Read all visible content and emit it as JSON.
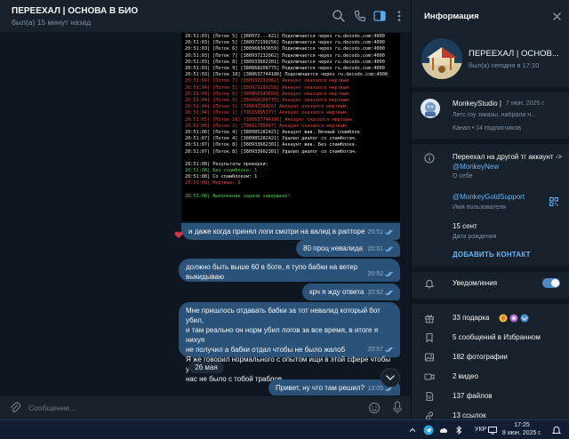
{
  "chat": {
    "title": "ПЕРЕЕХАЛ | ОСНОВА В БИО",
    "status": "был(а) 15 минут назад",
    "input_placeholder": "Сообщение..."
  },
  "terminal_lines": [
    {
      "c": "w",
      "t": "20:51:03| [Поток 5] [380972...421] Подключается через ru.decodo.com:4000"
    },
    {
      "c": "w",
      "t": "20:51:03| [Поток 5] [380972190256] Подключается через ru.decodo.com:4000"
    },
    {
      "c": "w",
      "t": "20:51:03| [Поток 6] [380968343659] Подключается через ru.decodo.com:4000"
    },
    {
      "c": "w",
      "t": "20:51:03| [Поток 7] [380937232062] Подключается через ru.decodo.com:4000"
    },
    {
      "c": "w",
      "t": "20:51:03| [Поток 8] [380933662301] Подключается через ru.decodo.com:4000"
    },
    {
      "c": "w",
      "t": "20:51:03| [Поток 9] [380868208775] Подключается через ru.decodo.com:4000"
    },
    {
      "c": "w",
      "t": "20:51:03| [Поток 10] [380637744186] Подключается через ru.decodo.com:4000"
    },
    {
      "c": "r",
      "t": "20:51:04| [Поток 7] [380937232062] Аккаунт оказался мертвым."
    },
    {
      "c": "r",
      "t": "20:51:04| [Поток 5] [380972190256] Аккаунт оказался мертвым."
    },
    {
      "c": "r",
      "t": "20:51:04| [Поток 6] [380968343659] Аккаунт оказался мертвым."
    },
    {
      "c": "r",
      "t": "20:51:04| [Поток 9] [380868208775] Аккаунт оказался мертвым."
    },
    {
      "c": "r",
      "t": "20:51:04| [Поток 3] [79014728420] Аккаунт оказался мертвым."
    },
    {
      "c": "r",
      "t": "20:51:04| [Поток 1] [79515865377] Аккаунт оказался мертвым."
    },
    {
      "c": "r",
      "t": "20:51:05| [Поток 10] [380637744186] Аккаунт оказался мертвым."
    },
    {
      "c": "r",
      "t": "20:51:05| [Поток 2] [79011705097] Аккаунт оказался мертвым."
    },
    {
      "c": "w",
      "t": "20:51:06| [Поток 4] [380985282421] Аккаунт жив. Вечный спамблок"
    },
    {
      "c": "w",
      "t": "20:51:07| [Поток 4] [380985282421] Удалил диалог со спамботом."
    },
    {
      "c": "w",
      "t": "20:51:07| [Поток 8] [380933662301] Аккаунт жив. Без спамблока."
    },
    {
      "c": "w",
      "t": "20:51:07| [Поток 8] [380933662301] Удалил диалог со спамботом."
    },
    {
      "c": "gap",
      "t": ""
    },
    {
      "c": "w",
      "t": "20:51:08| Результаты проверки:"
    },
    {
      "c": "g",
      "t": "20:51:08|     Без спамблока: 1"
    },
    {
      "c": "w",
      "t": "20:51:08|     Со спамблоком: 1"
    },
    {
      "c": "r",
      "t": "20:51:08|     Мертвые: 8"
    },
    {
      "c": "gap",
      "t": ""
    },
    {
      "c": "g",
      "t": "20:51:08| Выполнение задачи завершено!"
    }
  ],
  "messages": [
    {
      "text": "и даже когда принял логи смотри на валид в рапторе",
      "time": "20:51"
    },
    {
      "text": "80 проц невалида",
      "time": "20:51"
    },
    {
      "text": "должно быть выше 60 в боте, я тупо бабки на ветер выкидываю",
      "time": "20:52"
    },
    {
      "text": "крч я жду ответа",
      "time": "20:52"
    },
    {
      "lines": [
        "Мне пришлось отдавать бабки за тот невалид который бот убил,",
        "и там реально он норм убил логов за все время, в итоге я нихуя",
        "не получил а бабки отдал чтобы не было жалоб",
        "Я же говорил нормального с опытом ищи в этой сфере чтобы у",
        "нас не было с тобой траблов"
      ],
      "time": "20:57"
    },
    {
      "text": "Привет, ну что там решил?",
      "time": "13:05"
    }
  ],
  "date_separator": "26 мая",
  "info": {
    "title": "Информация",
    "profile_name": "ПЕРЕЕХАЛ | ОСНОВ...",
    "profile_status": "был(а) сегодня в 17:10",
    "channel": {
      "name": "MonkeyStudio | ...",
      "date": "7 июн. 2025 г.",
      "snippet": "Летс гоу заказы, набрали н...",
      "subscribers": "Канал • 14 подписчиков"
    },
    "about_prefix": "Переехал на другой тг аккаунт -> ",
    "about_link": "@MonkeyNew",
    "about_label": "О себе",
    "username": "@MonkeyGoldSupport",
    "username_label": "Имя пользователя",
    "birthday": "15 сент",
    "birthday_label": "Дата рождения",
    "add_contact": "ДОБАВИТЬ КОНТАКТ",
    "notifications": "Уведомления",
    "notifications_on": true,
    "media": [
      {
        "icon": "gift-icon",
        "label": "33 подарка"
      },
      {
        "icon": "bookmark-icon",
        "label": "5 сообщений в Избранном"
      },
      {
        "icon": "photo-icon",
        "label": "182 фотографии"
      },
      {
        "icon": "video-icon",
        "label": "2 видео"
      },
      {
        "icon": "file-icon",
        "label": "137 файлов"
      },
      {
        "icon": "link-icon",
        "label": "13 ссылок"
      }
    ]
  },
  "taskbar": {
    "lang": "УКР",
    "time": "17:25",
    "date": "8 июн. 2025 г."
  },
  "colors": {
    "bubble": "#2b5278",
    "accent": "#6ab3f3",
    "panel": "#17212b",
    "background": "#0e1621"
  }
}
